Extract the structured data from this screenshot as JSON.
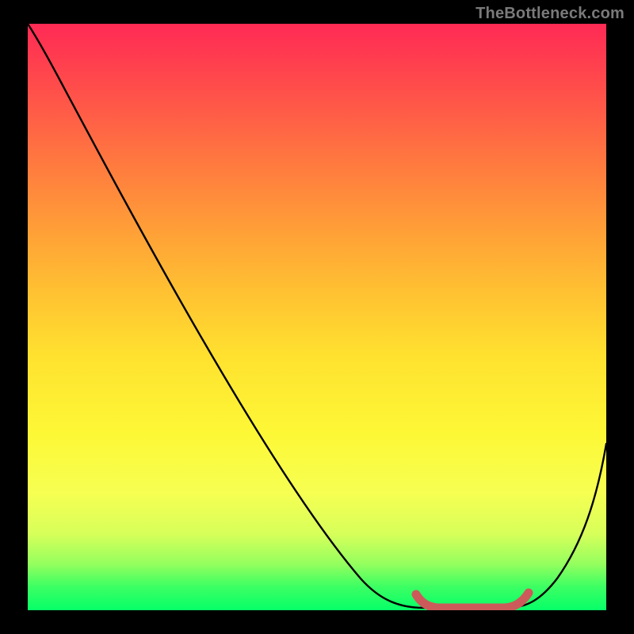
{
  "watermark": "TheBottleneck.com",
  "chart_data": {
    "type": "line",
    "title": "",
    "xlabel": "",
    "ylabel": "",
    "xlim": [
      0,
      100
    ],
    "ylim": [
      0,
      100
    ],
    "grid": false,
    "legend": false,
    "series": [
      {
        "name": "bottleneck-curve",
        "color": "#000000",
        "x": [
          0,
          4,
          10,
          20,
          30,
          40,
          50,
          58,
          62,
          66,
          70,
          74,
          78,
          82,
          86,
          90,
          94,
          100
        ],
        "y": [
          100,
          96,
          90,
          77.5,
          65,
          52,
          39,
          27,
          19,
          12,
          5,
          1,
          0,
          0,
          1,
          6,
          14,
          29
        ]
      },
      {
        "name": "optimal-band",
        "color": "#cc5a5a",
        "x": [
          70,
          74,
          78,
          82,
          86
        ],
        "y": [
          3,
          1,
          0,
          0,
          2
        ]
      }
    ],
    "background_gradient": {
      "top": "#ff2a55",
      "mid": "#ffe22f",
      "bottom": "#06ff68"
    }
  }
}
